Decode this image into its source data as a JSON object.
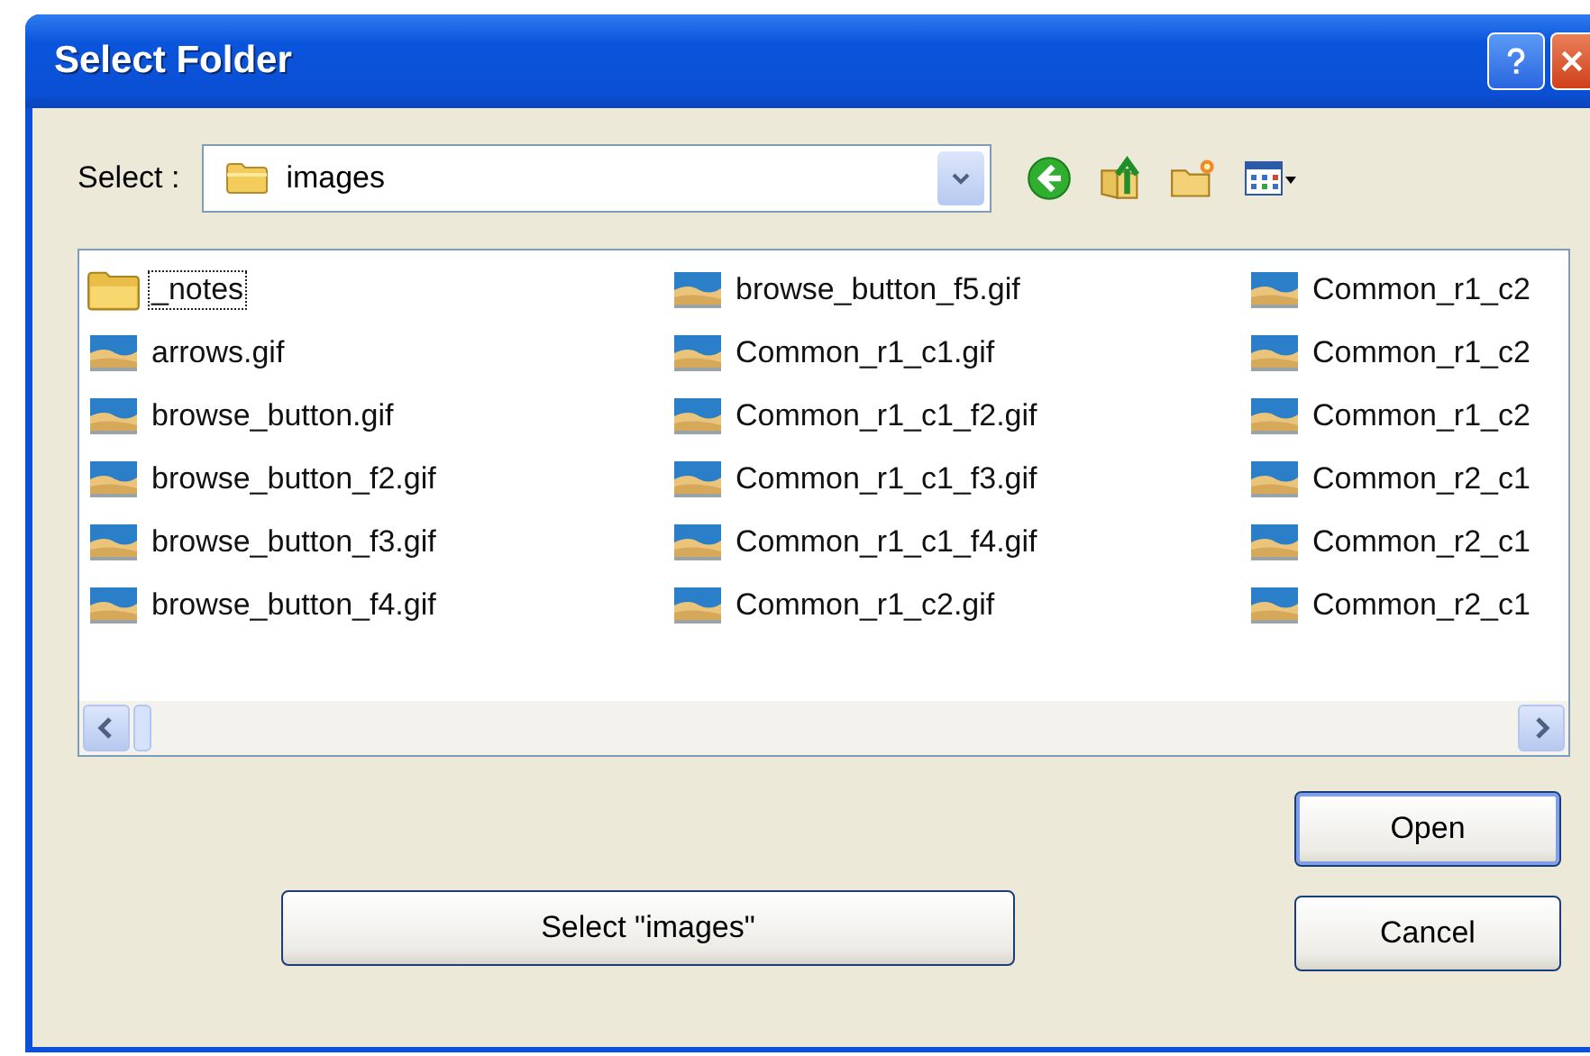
{
  "window": {
    "title": "Select Folder"
  },
  "location": {
    "label": "Select :",
    "value": "images"
  },
  "files": [
    {
      "kind": "folder",
      "name": "_notes",
      "focused": true
    },
    {
      "kind": "image",
      "name": "arrows.gif",
      "focused": false
    },
    {
      "kind": "image",
      "name": "browse_button.gif",
      "focused": false
    },
    {
      "kind": "image",
      "name": "browse_button_f2.gif",
      "focused": false
    },
    {
      "kind": "image",
      "name": "browse_button_f3.gif",
      "focused": false
    },
    {
      "kind": "image",
      "name": "browse_button_f4.gif",
      "focused": false
    },
    {
      "kind": "image",
      "name": "browse_button_f5.gif",
      "focused": false
    },
    {
      "kind": "image",
      "name": "Common_r1_c1.gif",
      "focused": false
    },
    {
      "kind": "image",
      "name": "Common_r1_c1_f2.gif",
      "focused": false
    },
    {
      "kind": "image",
      "name": "Common_r1_c1_f3.gif",
      "focused": false
    },
    {
      "kind": "image",
      "name": "Common_r1_c1_f4.gif",
      "focused": false
    },
    {
      "kind": "image",
      "name": "Common_r1_c2.gif",
      "focused": false
    },
    {
      "kind": "image",
      "name": "Common_r1_c2",
      "focused": false
    },
    {
      "kind": "image",
      "name": "Common_r1_c2",
      "focused": false
    },
    {
      "kind": "image",
      "name": "Common_r1_c2",
      "focused": false
    },
    {
      "kind": "image",
      "name": "Common_r2_c1",
      "focused": false
    },
    {
      "kind": "image",
      "name": "Common_r2_c1",
      "focused": false
    },
    {
      "kind": "image",
      "name": "Common_r2_c1",
      "focused": false
    }
  ],
  "buttons": {
    "select": "Select \"images\"",
    "open": "Open",
    "cancel": "Cancel"
  }
}
